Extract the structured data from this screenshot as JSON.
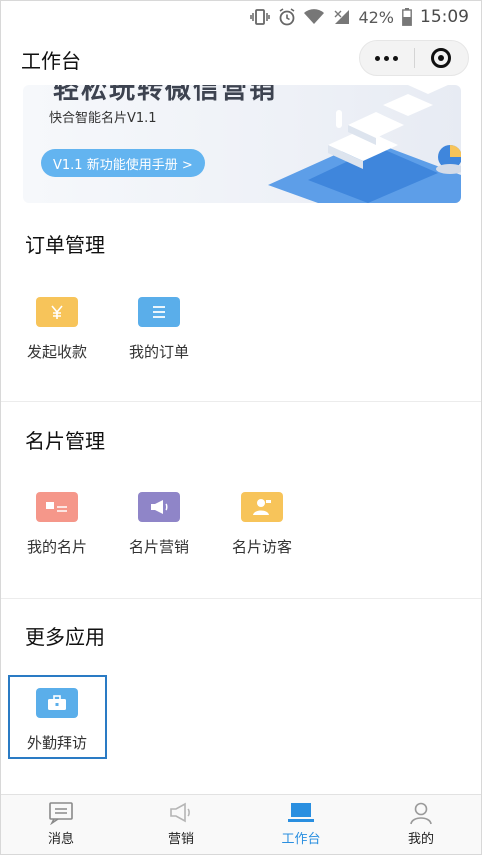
{
  "status_bar": {
    "battery": "42%",
    "time": "15:09"
  },
  "nav": {
    "title": "工作台"
  },
  "banner": {
    "headline": "轻松玩转微信营销",
    "subtitle": "快合智能名片V1.1",
    "button_label": "V1.1 新功能使用手册 >"
  },
  "sections": {
    "orders": {
      "title": "订单管理",
      "items": [
        {
          "label": "发起收款",
          "icon": "yen-icon",
          "color": "#f7c45a"
        },
        {
          "label": "我的订单",
          "icon": "list-icon",
          "color": "#5aaeea"
        }
      ]
    },
    "cards": {
      "title": "名片管理",
      "items": [
        {
          "label": "我的名片",
          "icon": "card-icon",
          "color": "#f5978a"
        },
        {
          "label": "名片营销",
          "icon": "megaphone-icon",
          "color": "#8f85c8"
        },
        {
          "label": "名片访客",
          "icon": "visitor-icon",
          "color": "#f7c45a"
        }
      ]
    },
    "more": {
      "title": "更多应用",
      "items": [
        {
          "label": "外勤拜访",
          "icon": "briefcase-icon",
          "color": "#5aaeea"
        }
      ]
    }
  },
  "tabbar": {
    "tabs": [
      {
        "label": "消息",
        "icon": "message-icon",
        "active": false
      },
      {
        "label": "营销",
        "icon": "megaphone-outline-icon",
        "active": false
      },
      {
        "label": "工作台",
        "icon": "laptop-icon",
        "active": true
      },
      {
        "label": "我的",
        "icon": "person-icon",
        "active": false
      }
    ],
    "active_color": "#2a8fe0"
  }
}
